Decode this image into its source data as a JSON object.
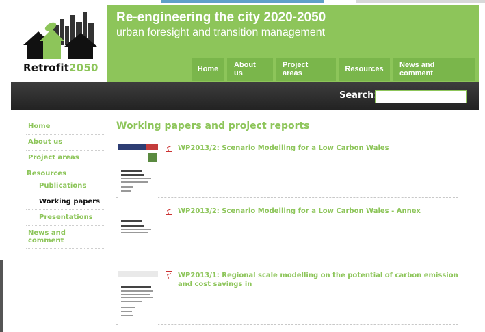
{
  "header": {
    "logo_text_a": "Retrofit",
    "logo_text_b": "2050",
    "title": "Re-engineering the city 2020-2050",
    "subtitle": "urban foresight and transition management"
  },
  "nav": {
    "items": [
      {
        "label": "Home"
      },
      {
        "label": "About us"
      },
      {
        "label": "Project areas"
      },
      {
        "label": "Resources"
      },
      {
        "label": "News and comment"
      }
    ]
  },
  "search": {
    "label": "Search:",
    "value": "",
    "placeholder": ""
  },
  "sidebar": {
    "items": [
      {
        "label": "Home"
      },
      {
        "label": "About us"
      },
      {
        "label": "Project areas"
      },
      {
        "label": "Resources"
      },
      {
        "label": "Publications"
      },
      {
        "label": "Working papers"
      },
      {
        "label": "Presentations"
      },
      {
        "label": "News and comment"
      }
    ],
    "current": "Working papers"
  },
  "main": {
    "title": "Working papers and project reports",
    "papers": [
      {
        "title": "WP2013/2: Scenario Modelling for a Low Carbon Wales",
        "icon": "pdf-icon"
      },
      {
        "title": "WP2013/2: Scenario Modelling for a Low Carbon Wales - Annex",
        "icon": "pdf-icon"
      },
      {
        "title": "WP2013/1: Regional scale modelling on the potential of carbon emission and cost savings in",
        "icon": "pdf-icon"
      }
    ]
  },
  "colors": {
    "brand_green": "#8dc55a",
    "nav_green": "#7ab64b",
    "bar_dark": "#2a2a2a"
  }
}
